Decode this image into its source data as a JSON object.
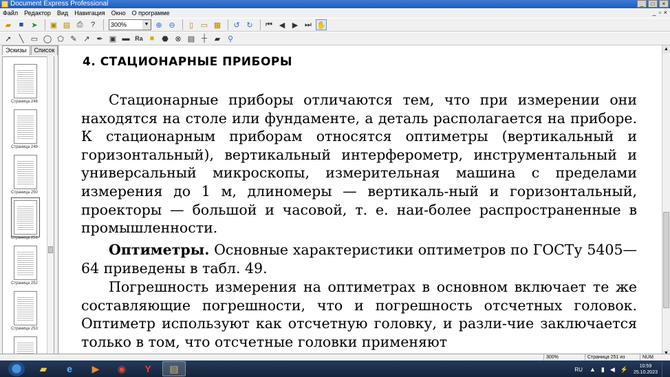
{
  "window": {
    "title": "Document Express Professional"
  },
  "menu": [
    "Файл",
    "Редактор",
    "Вид",
    "Навигация",
    "Окно",
    "О программе"
  ],
  "toolbar": {
    "zoom": "300%"
  },
  "sidebar": {
    "tabs": [
      "Эскизы",
      "Список"
    ],
    "thumbnails": [
      {
        "label": "Страница 248"
      },
      {
        "label": "Страница 249"
      },
      {
        "label": "Страница 250"
      },
      {
        "label": "Страница 251"
      },
      {
        "label": "Страница 252"
      },
      {
        "label": "Страница 253"
      }
    ]
  },
  "document": {
    "heading": "4. СТАЦИОНАРНЫЕ ПРИБОРЫ",
    "p1": "Стационарные приборы отличаются тем, что при измерении они находятся на столе или фундаменте, а деталь располагается на приборе. К стационарным приборам относятся оптиметры (вертикальный и горизонтальный), вертикальный интерферометр, инструментальный и универсальный микроскопы, измерительная машина с пределами измерения до 1 м, длиномеры — вертикаль-ный и горизонтальный, проекторы — большой и часовой, т. е. наи-более распространенные в промышленности.",
    "p2_bold": "Оптиметры.",
    "p2_rest": " Основные характеристики оптиметров по ГОСТу 5405—64 приведены в табл. 49.",
    "p3": "Погрешность измерения на оптиметрах в основном включает те же составляющие погрешности, что и погрешность отсчетных головок. Оптиметр используют как отсчетную головку, и разли-чие заключается только в том, что отсчетные головки применяют"
  },
  "status": {
    "zoom": "300%",
    "page": "Страница 251 из",
    "num": "NUM"
  },
  "taskbar": {
    "lang": "RU",
    "time": "10:59",
    "date": "25.10.2023"
  }
}
